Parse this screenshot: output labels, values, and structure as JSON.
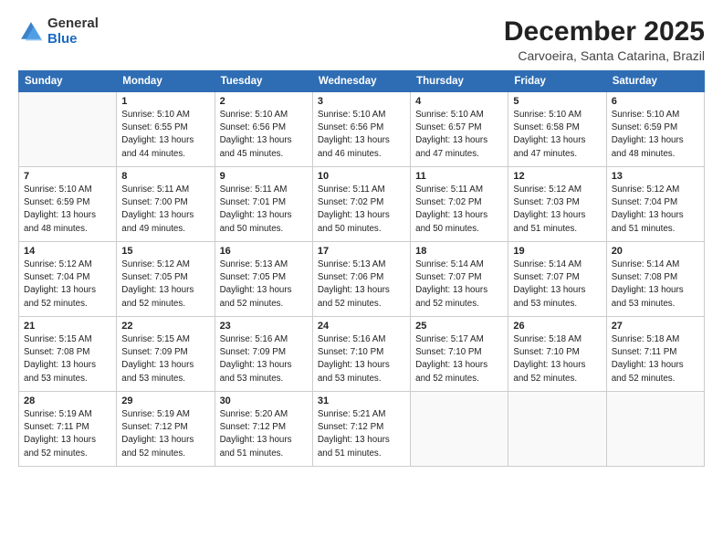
{
  "header": {
    "logo_general": "General",
    "logo_blue": "Blue",
    "month_year": "December 2025",
    "location": "Carvoeira, Santa Catarina, Brazil"
  },
  "weekdays": [
    "Sunday",
    "Monday",
    "Tuesday",
    "Wednesday",
    "Thursday",
    "Friday",
    "Saturday"
  ],
  "weeks": [
    [
      {
        "day": "",
        "detail": ""
      },
      {
        "day": "1",
        "detail": "Sunrise: 5:10 AM\nSunset: 6:55 PM\nDaylight: 13 hours\nand 44 minutes."
      },
      {
        "day": "2",
        "detail": "Sunrise: 5:10 AM\nSunset: 6:56 PM\nDaylight: 13 hours\nand 45 minutes."
      },
      {
        "day": "3",
        "detail": "Sunrise: 5:10 AM\nSunset: 6:56 PM\nDaylight: 13 hours\nand 46 minutes."
      },
      {
        "day": "4",
        "detail": "Sunrise: 5:10 AM\nSunset: 6:57 PM\nDaylight: 13 hours\nand 47 minutes."
      },
      {
        "day": "5",
        "detail": "Sunrise: 5:10 AM\nSunset: 6:58 PM\nDaylight: 13 hours\nand 47 minutes."
      },
      {
        "day": "6",
        "detail": "Sunrise: 5:10 AM\nSunset: 6:59 PM\nDaylight: 13 hours\nand 48 minutes."
      }
    ],
    [
      {
        "day": "7",
        "detail": "Sunrise: 5:10 AM\nSunset: 6:59 PM\nDaylight: 13 hours\nand 48 minutes."
      },
      {
        "day": "8",
        "detail": "Sunrise: 5:11 AM\nSunset: 7:00 PM\nDaylight: 13 hours\nand 49 minutes."
      },
      {
        "day": "9",
        "detail": "Sunrise: 5:11 AM\nSunset: 7:01 PM\nDaylight: 13 hours\nand 50 minutes."
      },
      {
        "day": "10",
        "detail": "Sunrise: 5:11 AM\nSunset: 7:02 PM\nDaylight: 13 hours\nand 50 minutes."
      },
      {
        "day": "11",
        "detail": "Sunrise: 5:11 AM\nSunset: 7:02 PM\nDaylight: 13 hours\nand 50 minutes."
      },
      {
        "day": "12",
        "detail": "Sunrise: 5:12 AM\nSunset: 7:03 PM\nDaylight: 13 hours\nand 51 minutes."
      },
      {
        "day": "13",
        "detail": "Sunrise: 5:12 AM\nSunset: 7:04 PM\nDaylight: 13 hours\nand 51 minutes."
      }
    ],
    [
      {
        "day": "14",
        "detail": "Sunrise: 5:12 AM\nSunset: 7:04 PM\nDaylight: 13 hours\nand 52 minutes."
      },
      {
        "day": "15",
        "detail": "Sunrise: 5:12 AM\nSunset: 7:05 PM\nDaylight: 13 hours\nand 52 minutes."
      },
      {
        "day": "16",
        "detail": "Sunrise: 5:13 AM\nSunset: 7:05 PM\nDaylight: 13 hours\nand 52 minutes."
      },
      {
        "day": "17",
        "detail": "Sunrise: 5:13 AM\nSunset: 7:06 PM\nDaylight: 13 hours\nand 52 minutes."
      },
      {
        "day": "18",
        "detail": "Sunrise: 5:14 AM\nSunset: 7:07 PM\nDaylight: 13 hours\nand 52 minutes."
      },
      {
        "day": "19",
        "detail": "Sunrise: 5:14 AM\nSunset: 7:07 PM\nDaylight: 13 hours\nand 53 minutes."
      },
      {
        "day": "20",
        "detail": "Sunrise: 5:14 AM\nSunset: 7:08 PM\nDaylight: 13 hours\nand 53 minutes."
      }
    ],
    [
      {
        "day": "21",
        "detail": "Sunrise: 5:15 AM\nSunset: 7:08 PM\nDaylight: 13 hours\nand 53 minutes."
      },
      {
        "day": "22",
        "detail": "Sunrise: 5:15 AM\nSunset: 7:09 PM\nDaylight: 13 hours\nand 53 minutes."
      },
      {
        "day": "23",
        "detail": "Sunrise: 5:16 AM\nSunset: 7:09 PM\nDaylight: 13 hours\nand 53 minutes."
      },
      {
        "day": "24",
        "detail": "Sunrise: 5:16 AM\nSunset: 7:10 PM\nDaylight: 13 hours\nand 53 minutes."
      },
      {
        "day": "25",
        "detail": "Sunrise: 5:17 AM\nSunset: 7:10 PM\nDaylight: 13 hours\nand 52 minutes."
      },
      {
        "day": "26",
        "detail": "Sunrise: 5:18 AM\nSunset: 7:10 PM\nDaylight: 13 hours\nand 52 minutes."
      },
      {
        "day": "27",
        "detail": "Sunrise: 5:18 AM\nSunset: 7:11 PM\nDaylight: 13 hours\nand 52 minutes."
      }
    ],
    [
      {
        "day": "28",
        "detail": "Sunrise: 5:19 AM\nSunset: 7:11 PM\nDaylight: 13 hours\nand 52 minutes."
      },
      {
        "day": "29",
        "detail": "Sunrise: 5:19 AM\nSunset: 7:12 PM\nDaylight: 13 hours\nand 52 minutes."
      },
      {
        "day": "30",
        "detail": "Sunrise: 5:20 AM\nSunset: 7:12 PM\nDaylight: 13 hours\nand 51 minutes."
      },
      {
        "day": "31",
        "detail": "Sunrise: 5:21 AM\nSunset: 7:12 PM\nDaylight: 13 hours\nand 51 minutes."
      },
      {
        "day": "",
        "detail": ""
      },
      {
        "day": "",
        "detail": ""
      },
      {
        "day": "",
        "detail": ""
      }
    ]
  ]
}
